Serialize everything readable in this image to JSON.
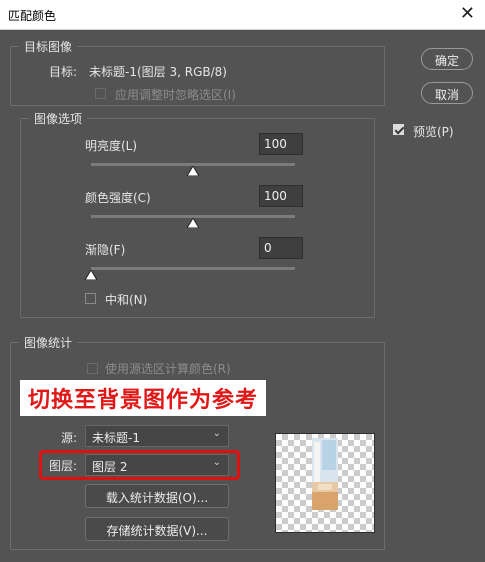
{
  "window": {
    "title": "匹配颜色",
    "close_glyph": "✕"
  },
  "target_image": {
    "legend": "目标图像",
    "target_label": "目标:",
    "target_value": "未标题-1(图层 3, RGB/8)",
    "apply_selection_label": "应用调整时忽略选区(I)",
    "apply_selection_checked": false
  },
  "image_options": {
    "legend": "图像选项",
    "luminance": {
      "label": "明亮度(L)",
      "value": "100",
      "level": 100,
      "max": 200
    },
    "color_intensity": {
      "label": "颜色强度(C)",
      "value": "100",
      "level": 100,
      "max": 200
    },
    "fade": {
      "label": "渐隐(F)",
      "value": "0",
      "level": 0,
      "max": 100
    },
    "neutralize": {
      "label": "中和(N)",
      "checked": false
    }
  },
  "buttons": {
    "ok": "确定",
    "cancel": "取消"
  },
  "preview": {
    "label": "预览(P)",
    "checked": true
  },
  "image_stats": {
    "legend": "图像统计",
    "use_source_selection_label": "使用源选区计算颜色(R)",
    "annotation": "切换至背景图作为参考",
    "source_label": "源:",
    "source_value": "未标题-1",
    "layer_label": "图层:",
    "layer_value": "图层 2",
    "load_stats": "载入统计数据(O)...",
    "save_stats": "存储统计数据(V)..."
  },
  "colors": {
    "annotation": "#e01818",
    "background": "#535353"
  }
}
